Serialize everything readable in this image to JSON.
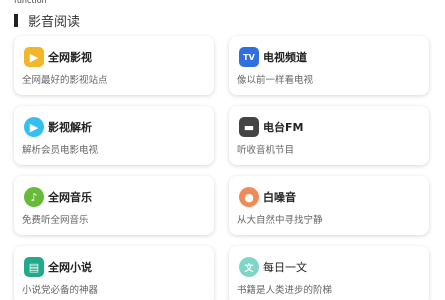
{
  "top_fragment": "function",
  "section": {
    "title": "影音阅读"
  },
  "cards": [
    {
      "name": "全网影视",
      "desc": "全网最好的影视站点",
      "icon": "film-clapper-icon",
      "color": "#f2b62a",
      "glyph": "▶"
    },
    {
      "name": "电视频道",
      "desc": "像以前一样看电视",
      "icon": "tv-icon",
      "color": "#2f6fe0",
      "glyph": "TV"
    },
    {
      "name": "影视解析",
      "desc": "解析会员电影电视",
      "icon": "play-triangle-icon",
      "color": "#34c0ef",
      "glyph": "▶"
    },
    {
      "name": "电台FM",
      "desc": "听收音机节目",
      "icon": "radio-icon",
      "color": "#444444",
      "glyph": "▬"
    },
    {
      "name": "全网音乐",
      "desc": "免费听全网音乐",
      "icon": "music-note-icon",
      "color": "#66bb3a",
      "glyph": "♪"
    },
    {
      "name": "白噪音",
      "desc": "从大自然中寻找宁静",
      "icon": "white-noise-icon",
      "color": "#f08a5a",
      "glyph": "●"
    },
    {
      "name": "全网小说",
      "desc": "小说党必备的神器",
      "icon": "book-icon",
      "color": "#22a88a",
      "glyph": "▤"
    },
    {
      "name": "每日一文",
      "desc": "书籍是人类进步的阶梯",
      "icon": "daily-article-icon",
      "color": "#7fd6c6",
      "glyph": "文"
    }
  ]
}
